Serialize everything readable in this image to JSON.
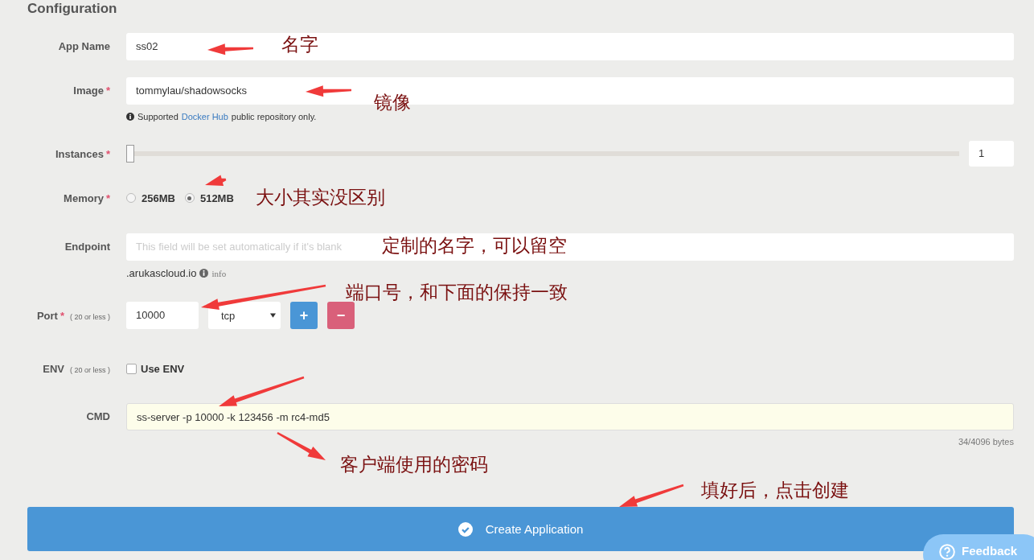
{
  "section_title": "Configuration",
  "app_name": {
    "label": "App Name",
    "value": "ss02"
  },
  "image": {
    "label": "Image",
    "required_mark": "*",
    "value": "tommylau/shadowsocks",
    "hint_before": "Supported",
    "hint_link": "Docker Hub",
    "hint_after": "public repository only."
  },
  "instances": {
    "label": "Instances",
    "required_mark": "*",
    "level": 0,
    "value": "1"
  },
  "memory": {
    "label": "Memory",
    "required_mark": "*",
    "options": [
      {
        "label": "256MB",
        "selected": false
      },
      {
        "label": "512MB",
        "selected": true
      }
    ]
  },
  "endpoint": {
    "label": "Endpoint",
    "placeholder": "This field will be set automatically if it's blank",
    "suffix": ".arukascloud.io",
    "info_link": "info"
  },
  "port": {
    "label": "Port",
    "required_mark": "*",
    "note": "( 20 or less )",
    "value": "10000",
    "protocol": "tcp",
    "add_button": "+",
    "remove_button": "−"
  },
  "env": {
    "label": "ENV",
    "note": "( 20 or less )",
    "checkbox_label": "Use ENV",
    "checked": false
  },
  "cmd": {
    "label": "CMD",
    "value": "ss-server -p 10000 -k 123456 -m rc4-md5",
    "byte_count": "34/4096 bytes"
  },
  "create_button": "Create Application",
  "feedback_button": "Feedback",
  "annotations": [
    {
      "text": "名字"
    },
    {
      "text": "镜像"
    },
    {
      "text": "大小其实没区别"
    },
    {
      "text": "定制的名字，可以留空"
    },
    {
      "text": "端口号，和下面的保持一致"
    },
    {
      "text": "客户端使用的密码"
    },
    {
      "text": "填好后，点击创建"
    }
  ]
}
